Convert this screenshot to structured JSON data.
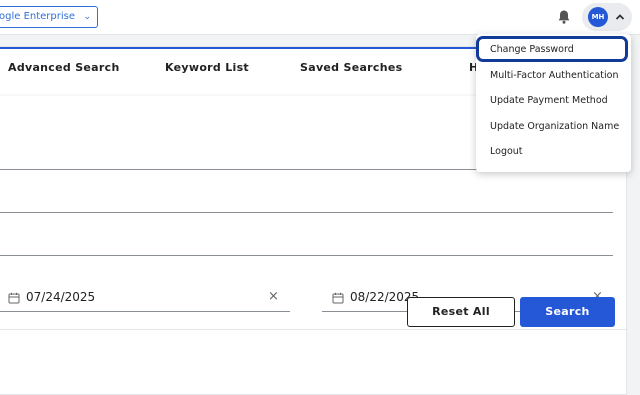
{
  "header": {
    "org_select": "ogle Enterprise",
    "avatar_initials": "MH"
  },
  "tabs": [
    {
      "label": "Advanced Search"
    },
    {
      "label": "Keyword List"
    },
    {
      "label": "Saved Searches"
    },
    {
      "label": "H"
    }
  ],
  "dates": {
    "from": "07/24/2025",
    "to": "08/22/2025"
  },
  "buttons": {
    "reset": "Reset All",
    "search": "Search"
  },
  "user_menu": [
    {
      "label": "Change Password"
    },
    {
      "label": "Multi-Factor Authentication"
    },
    {
      "label": "Update Payment Method"
    },
    {
      "label": "Update Organization Name"
    },
    {
      "label": "Logout"
    }
  ],
  "colors": {
    "accent": "#2458d6",
    "focus_ring": "#123a99"
  }
}
